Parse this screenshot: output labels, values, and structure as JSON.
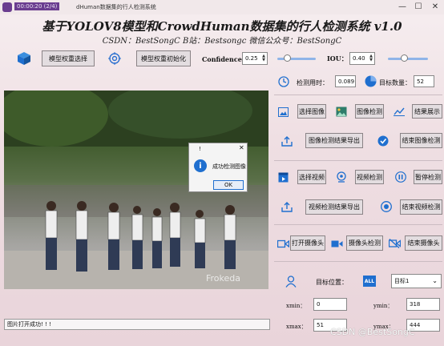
{
  "window": {
    "title": "dHuman数据集的行人检测系统",
    "timestamp": "00:00:20 (2/4)",
    "minimize": "—",
    "maximize": "☐",
    "close": "✕"
  },
  "header": {
    "title": "基于YOLOV8模型和CrowdHuman数据集的行人检测系统 v1.0",
    "subtitle": "CSDN：BestSongC   B站：Bestsongc   微信公众号：BestSongC"
  },
  "toolbar": {
    "select_weights": "模型权重选择",
    "init_weights": "模型权重初始化",
    "confidence_label": "Confidence:",
    "confidence_value": "0.25",
    "confidence_level": 0.25,
    "iou_label": "IOU：",
    "iou_value": "0.40",
    "iou_level": 0.4
  },
  "stats": {
    "time_label": "检测用时：",
    "time_value": "0.089",
    "count_label": "目标数量：",
    "count_value": "52"
  },
  "image_section": {
    "select_image": "选择图像",
    "detect_image": "图像检测",
    "show_result": "结果展示",
    "export_image": "图像检测结果导出",
    "end_image": "结束图像检测"
  },
  "video_section": {
    "select_video": "选择视频",
    "detect_video": "视频检测",
    "pause": "暂停检测",
    "export_video": "视频检测结果导出",
    "end_video": "结束视频检测"
  },
  "camera_section": {
    "open_camera": "打开摄像头",
    "detect_camera": "摄像头检测",
    "close_camera": "结束摄像头"
  },
  "target": {
    "position_label": "目标位置：",
    "all_icon_text": "ALL",
    "target_select": "目标1",
    "xmin_label": "xmin：",
    "xmin_value": "0",
    "ymin_label": "ymin：",
    "ymin_value": "318",
    "xmax_label": "xmax：",
    "xmax_value": "51",
    "ymax_label": "ymax：",
    "ymax_value": "444"
  },
  "dialog": {
    "title_icon": "!",
    "message": "成功检测图像",
    "ok": "OK",
    "close": "✕"
  },
  "photo": {
    "watermark": "Frokeda"
  },
  "status_bar": "图片打开成功! ! !",
  "watermark": "CSDN @BestSongC",
  "colors": {
    "accent_blue": "#1f6fcf",
    "slider_blue": "#8fb4e8",
    "window_purple": "#6a3c8f"
  }
}
